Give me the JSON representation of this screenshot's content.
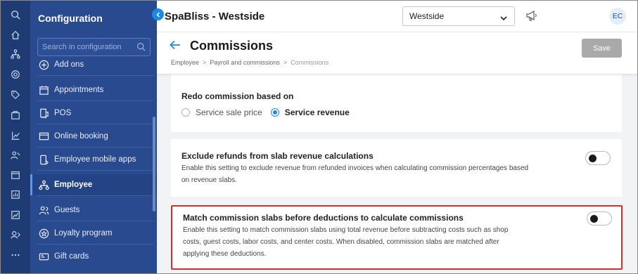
{
  "sidebar": {
    "title": "Configuration",
    "search_placeholder": "Search in configuration",
    "items": [
      {
        "label": "Add ons",
        "icon": "plus-circle-icon"
      },
      {
        "label": "Appointments",
        "icon": "calendar-icon"
      },
      {
        "label": "POS",
        "icon": "receipt-icon"
      },
      {
        "label": "Online booking",
        "icon": "web-booking-icon"
      },
      {
        "label": "Employee mobile apps",
        "icon": "mobile-app-icon"
      },
      {
        "label": "Employee",
        "icon": "employee-icon",
        "active": true
      },
      {
        "label": "Guests",
        "icon": "guests-icon"
      },
      {
        "label": "Loyalty program",
        "icon": "loyalty-icon"
      },
      {
        "label": "Gift cards",
        "icon": "gift-card-icon"
      }
    ]
  },
  "header": {
    "app_title": "SpaBliss - Westside",
    "location": "Westside",
    "avatar_initials": "EC"
  },
  "page": {
    "title": "Commissions",
    "breadcrumb": [
      "Employee",
      "Payroll and commissions",
      "Commissions"
    ],
    "save_label": "Save"
  },
  "settings": {
    "redo": {
      "title": "Redo commission based on",
      "options": [
        "Service sale price",
        "Service revenue"
      ],
      "selected": "Service revenue"
    },
    "exclude_refunds": {
      "title": "Exclude refunds from slab revenue calculations",
      "description": "Enable this setting to exclude revenue from refunded invoices when calculating commission percentages based on revenue slabs.",
      "enabled": false
    },
    "match_slabs": {
      "title": "Match commission slabs before deductions to calculate commissions",
      "description": "Enable this setting to match commission slabs using total revenue before subtracting costs such as shop costs, guest costs, labor costs, and center costs. When disabled, commission slabs are matched after applying these deductions.",
      "enabled": false
    }
  },
  "colors": {
    "rail": "#1f3b73",
    "sidebar": "#2a4a8f",
    "accent": "#1e88e5",
    "highlight_border": "#d32f2f"
  }
}
